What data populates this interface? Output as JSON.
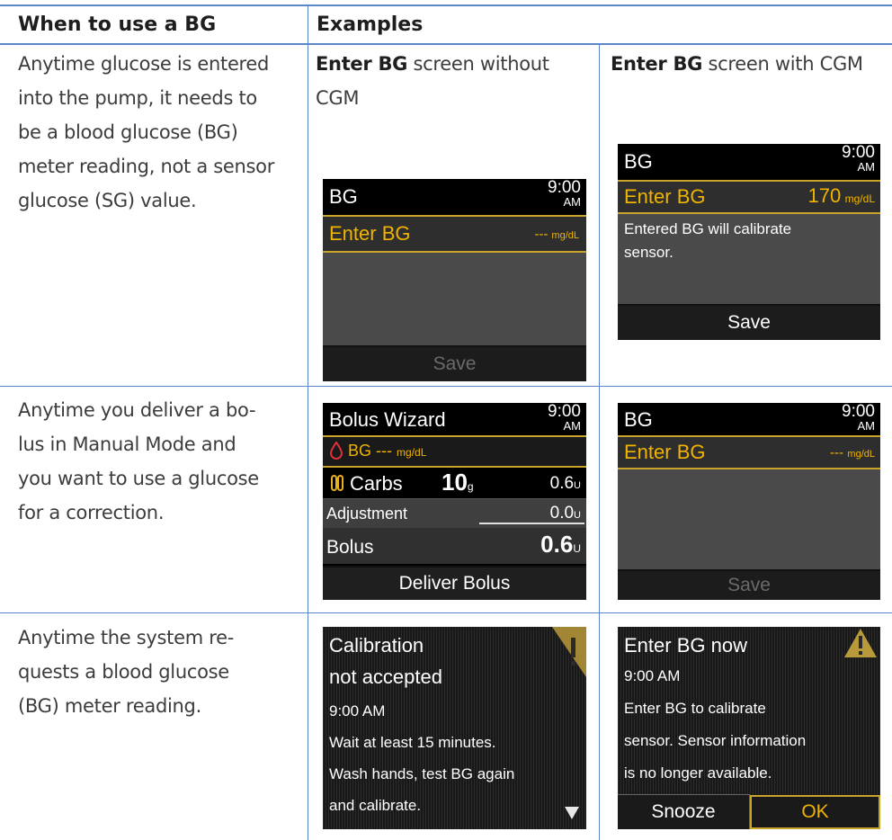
{
  "table": {
    "col1_header": "When to use a BG",
    "col2_header": "Examples",
    "rows": [
      {
        "when": [
          "Anytime glucose is entered",
          "into the pump, it needs to",
          "be a blood glucose (BG)",
          "meter reading, not a sensor",
          "glucose (SG) value."
        ],
        "ex1_caption_bold": "Enter BG",
        "ex1_caption_line1": " screen without",
        "ex1_caption_line2": "CGM",
        "ex2_caption_bold": "Enter BG",
        "ex2_caption_rest": " screen with CGM"
      },
      {
        "when": [
          "Anytime you deliver a bo-",
          "lus in Manual Mode and",
          "you want to use a glucose",
          "for a correction."
        ]
      },
      {
        "when": [
          "Anytime the system re-",
          "quests a blood glucose",
          "(BG) meter reading."
        ]
      }
    ]
  },
  "screens": {
    "bg_no_cgm": {
      "title": "BG",
      "time": "9:00",
      "ampm": "AM",
      "row_label": "Enter BG",
      "row_value": "---",
      "row_unit": "mg/dL",
      "save": "Save"
    },
    "bg_cgm": {
      "title": "BG",
      "time": "9:00",
      "ampm": "AM",
      "row_label": "Enter BG",
      "row_value": "170",
      "row_unit": "mg/dL",
      "message_line1": "Entered BG will calibrate",
      "message_line2": "sensor.",
      "save": "Save"
    },
    "bolus_wizard": {
      "title": "Bolus Wizard",
      "time": "9:00",
      "ampm": "AM",
      "bg_label": "BG",
      "bg_value": "---",
      "bg_unit": "mg/dL",
      "carbs_label": "Carbs",
      "carbs_value": "10",
      "carbs_unit": "g",
      "carbs_insulin": "0.6",
      "carbs_insulin_unit": "U",
      "adjust_label": "Adjustment",
      "adjust_value": "0.0",
      "adjust_unit": "U",
      "bolus_label": "Bolus",
      "bolus_value": "0.6",
      "bolus_unit": "U",
      "deliver": "Deliver Bolus"
    },
    "bg_manual": {
      "title": "BG",
      "time": "9:00",
      "ampm": "AM",
      "row_label": "Enter BG",
      "row_value": "---",
      "row_unit": "mg/dL",
      "save": "Save"
    },
    "calib_alert": {
      "line1": "Calibration",
      "line2": "not accepted",
      "time": "9:00 AM",
      "msg1": "Wait at least 15 minutes.",
      "msg2": "Wash hands, test BG again",
      "msg3": "and calibrate."
    },
    "enter_bg_alert": {
      "line1": "Enter BG now",
      "time": "9:00 AM",
      "msg1": "Enter BG to calibrate",
      "msg2": "sensor. Sensor information",
      "msg3": "is no longer available.",
      "snooze": "Snooze",
      "ok": "OK"
    }
  },
  "colors": {
    "rule": "#5b86c8",
    "accent_yellow": "#f0b400",
    "gold_line": "#c9a32a"
  }
}
